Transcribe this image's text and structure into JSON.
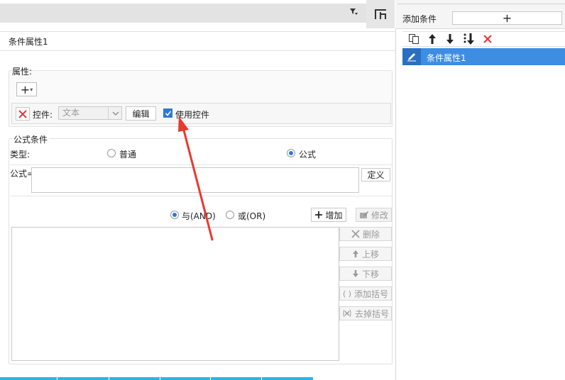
{
  "toolbar": {
    "filter_icon": "filter-dropdown-icon",
    "layout_icon": "layout-icon"
  },
  "right_panel": {
    "add_condition_label": "添加条件",
    "add_button_label": "+",
    "tools": [
      "copy-icon",
      "arrow-up-icon",
      "arrow-down-icon",
      "sort-icon",
      "delete-icon"
    ],
    "items": [
      {
        "label": "条件属性1",
        "selected": true
      }
    ]
  },
  "main": {
    "tab_title": "条件属性1",
    "property": {
      "label": "属性:",
      "add_label": "+",
      "control_label": "控件:",
      "control_value": "文本",
      "edit_label": "编辑",
      "use_control_label": "使用控件",
      "use_control_checked": true
    },
    "formula": {
      "section_label": "公式条件",
      "type_label": "类型:",
      "type_normal": "普通",
      "type_formula": "公式",
      "selected_type": "公式",
      "formula_label": "公式=",
      "formula_value": "",
      "define_label": "定义",
      "and_label": "与(AND)",
      "or_label": "或(OR)",
      "selected_logic": "AND",
      "add_label": "增加",
      "modify_label": "修改",
      "delete_label": "删除",
      "up_label": "上移",
      "down_label": "下移",
      "add_bracket_label": "添加括号",
      "remove_bracket_label": "去掉括号"
    }
  },
  "colors": {
    "accent": "#3d8de2",
    "delete_red": "#e23a3a",
    "annotation_arrow": "#e8392f",
    "bottom_strip": "#29b6e0"
  }
}
